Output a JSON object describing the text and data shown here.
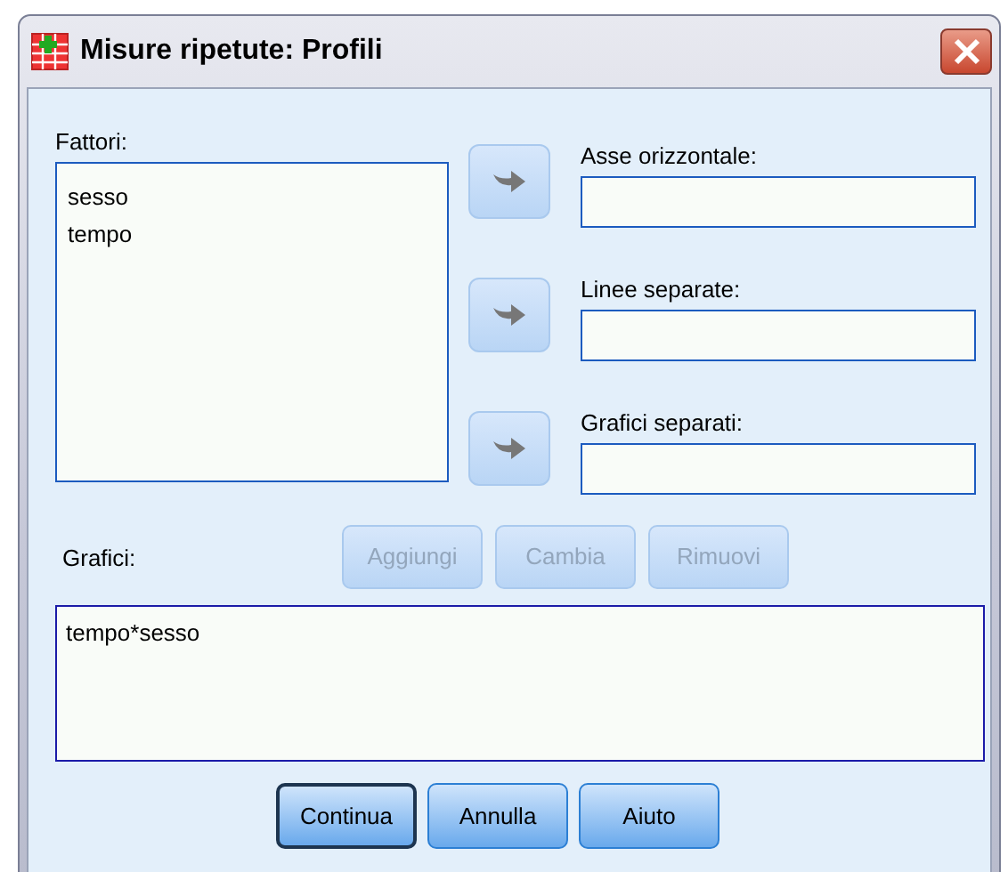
{
  "window": {
    "title": "Misure ripetute: Profili"
  },
  "factors": {
    "label": "Fattori:",
    "items": [
      "sesso",
      "tempo"
    ]
  },
  "targets": [
    {
      "label": "Asse orizzontale:"
    },
    {
      "label": "Linee separate:"
    },
    {
      "label": "Grafici separati:"
    }
  ],
  "plots": {
    "label": "Grafici:",
    "buttons": [
      {
        "label": "Aggiungi",
        "disabled": true
      },
      {
        "label": "Cambia",
        "disabled": true
      },
      {
        "label": "Rimuovi",
        "disabled": true
      }
    ],
    "items": [
      "tempo*sesso"
    ]
  },
  "buttons": [
    {
      "label": "Continua",
      "default": true
    },
    {
      "label": "Annulla",
      "default": false
    },
    {
      "label": "Aiuto",
      "default": false
    }
  ]
}
